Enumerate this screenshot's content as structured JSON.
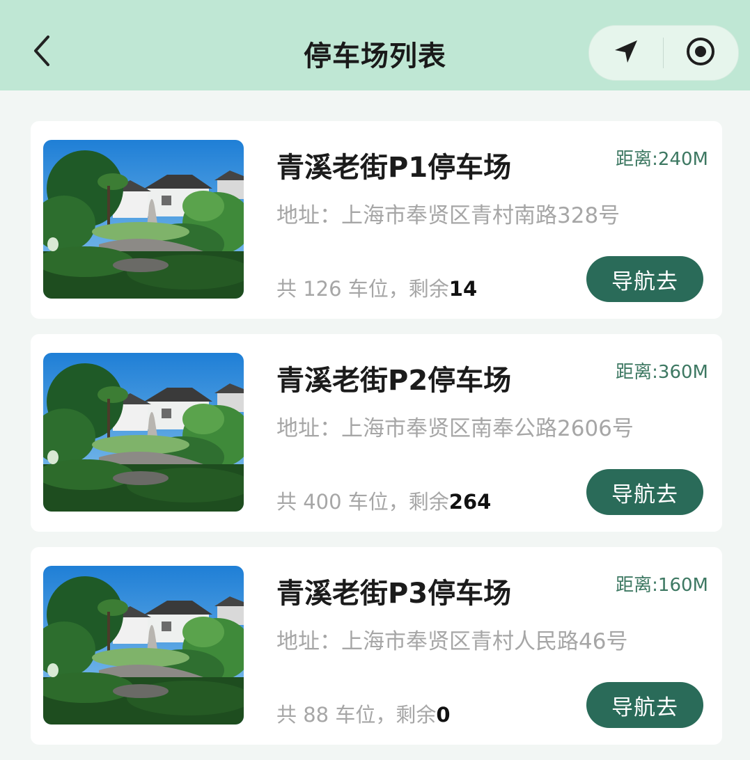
{
  "header": {
    "title": "停车场列表",
    "back_icon": "chevron-left-icon",
    "capsule": [
      "location-arrow-icon",
      "record-target-icon"
    ],
    "background_color": "#bfe7d4"
  },
  "colors": {
    "accent": "#2a6b59",
    "distance_text": "#3d7862",
    "muted_text": "#a6a6a6"
  },
  "lots": [
    {
      "name": "青溪老街P1停车场",
      "distance": "距离:240M",
      "address": "地址：上海市奉贤区青村南路328号",
      "spaces_prefix": "共 126 车位，剩余",
      "remaining": "14",
      "nav_label": "导航去"
    },
    {
      "name": "青溪老街P2停车场",
      "distance": "距离:360M",
      "address": "地址：上海市奉贤区南奉公路2606号",
      "spaces_prefix": "共 400 车位，剩余",
      "remaining": "264",
      "nav_label": "导航去"
    },
    {
      "name": "青溪老街P3停车场",
      "distance": "距离:160M",
      "address": "地址：上海市奉贤区青村人民路46号",
      "spaces_prefix": "共 88 车位，剩余",
      "remaining": "0",
      "nav_label": "导航去"
    }
  ]
}
